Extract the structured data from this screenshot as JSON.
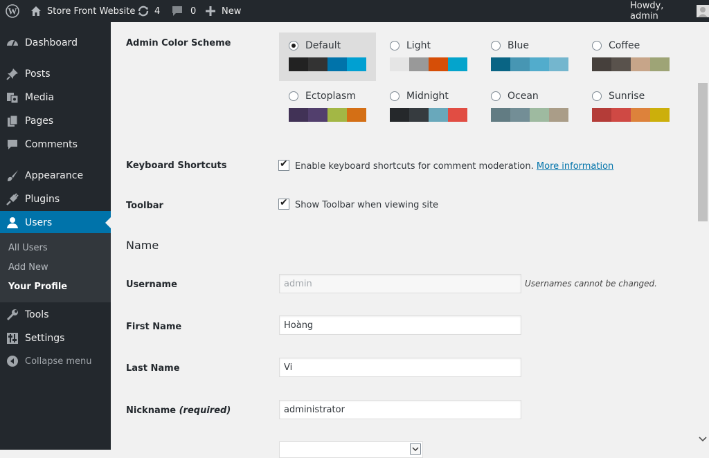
{
  "admin_bar": {
    "site_name": "Store Front Website",
    "updates_count": "4",
    "comments_count": "0",
    "new_label": "New",
    "greeting": "Howdy, admin",
    "icons": [
      "wordpress-logo-icon",
      "home-icon",
      "updates-icon",
      "comment-bubble-icon",
      "plus-icon",
      "avatar"
    ]
  },
  "sidebar": {
    "items": [
      {
        "label": "Dashboard",
        "icon": "dashboard-icon"
      },
      {
        "label": "Posts",
        "icon": "pushpin-icon"
      },
      {
        "label": "Media",
        "icon": "media-icon"
      },
      {
        "label": "Pages",
        "icon": "pages-icon"
      },
      {
        "label": "Comments",
        "icon": "comment-icon"
      },
      {
        "label": "Appearance",
        "icon": "paintbrush-icon"
      },
      {
        "label": "Plugins",
        "icon": "plugin-icon"
      },
      {
        "label": "Users",
        "icon": "users-icon"
      },
      {
        "label": "Tools",
        "icon": "wrench-icon"
      },
      {
        "label": "Settings",
        "icon": "settings-icon"
      }
    ],
    "submenu": [
      "All Users",
      "Add New",
      "Your Profile"
    ],
    "collapse_label": "Collapse menu",
    "active_color": "#0073aa"
  },
  "color_scheme": {
    "label": "Admin Color Scheme",
    "selected": "Default",
    "schemes": [
      {
        "name": "Default",
        "colors": [
          "#222222",
          "#333333",
          "#0073aa",
          "#00a0d2"
        ]
      },
      {
        "name": "Light",
        "colors": [
          "#e5e5e5",
          "#999999",
          "#d64e07",
          "#04a4cc"
        ]
      },
      {
        "name": "Blue",
        "colors": [
          "#096484",
          "#4796b3",
          "#52accc",
          "#74b6ce"
        ]
      },
      {
        "name": "Coffee",
        "colors": [
          "#46403c",
          "#59524c",
          "#c7a589",
          "#9ea476"
        ]
      },
      {
        "name": "Ectoplasm",
        "colors": [
          "#413256",
          "#523f6d",
          "#a3b745",
          "#d46f15"
        ]
      },
      {
        "name": "Midnight",
        "colors": [
          "#25282b",
          "#363b3f",
          "#69a8bb",
          "#e14d43"
        ]
      },
      {
        "name": "Ocean",
        "colors": [
          "#627c83",
          "#738e96",
          "#9ebaa0",
          "#aa9d88"
        ]
      },
      {
        "name": "Sunrise",
        "colors": [
          "#b43c38",
          "#cf4944",
          "#dd823b",
          "#ccaf0b"
        ]
      }
    ]
  },
  "keyboard_shortcuts": {
    "label": "Keyboard Shortcuts",
    "text": "Enable keyboard shortcuts for comment moderation.",
    "link": "More information",
    "checked": true
  },
  "toolbar": {
    "label": "Toolbar",
    "text": "Show Toolbar when viewing site",
    "checked": true
  },
  "name_section": {
    "title": "Name",
    "username_label": "Username",
    "username_value": "admin",
    "username_desc": "Usernames cannot be changed.",
    "first_name_label": "First Name",
    "first_name_value": "Hoàng",
    "last_name_label": "Last Name",
    "last_name_value": "Vi",
    "nickname_label": "Nickname",
    "nickname_required": "(required)",
    "nickname_value": "administrator"
  }
}
